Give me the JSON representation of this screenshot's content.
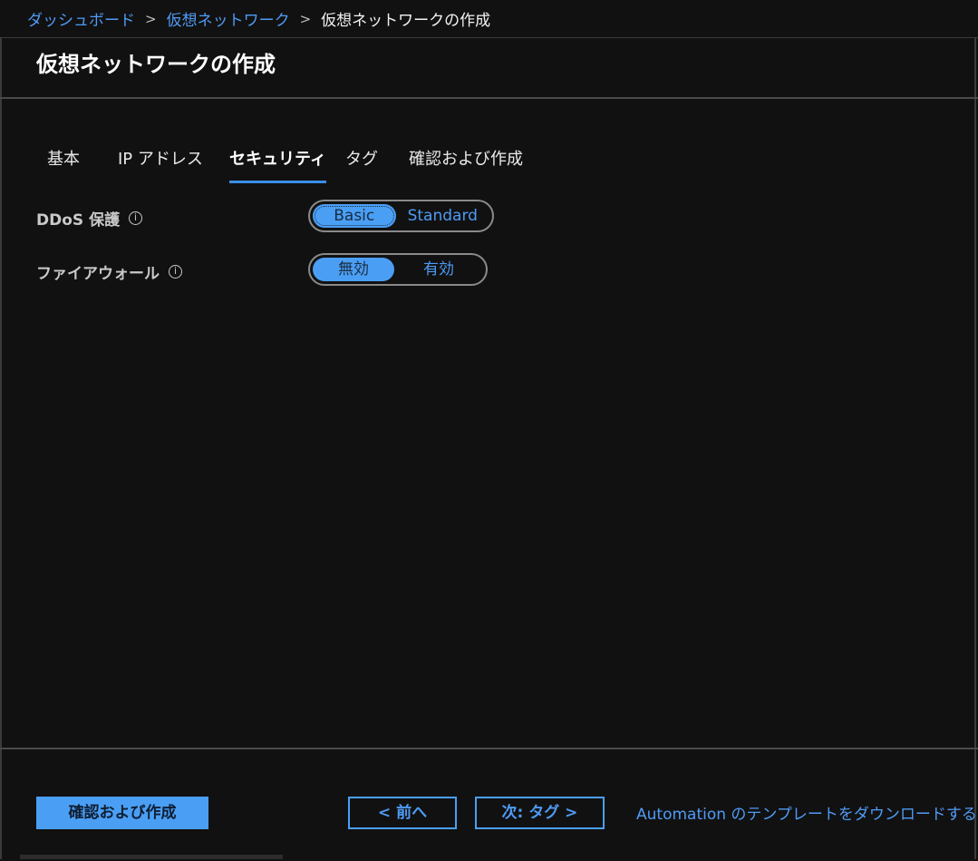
{
  "breadcrumb": {
    "items": [
      "ダッシュボード",
      "仮想ネットワーク"
    ],
    "separator": ">",
    "current": "仮想ネットワークの作成"
  },
  "page": {
    "title": "仮想ネットワークの作成"
  },
  "tabs": [
    {
      "label": "基本",
      "active": false
    },
    {
      "label": "IP アドレス",
      "active": false
    },
    {
      "label": "セキュリティ",
      "active": true
    },
    {
      "label": "タグ",
      "active": false
    },
    {
      "label": "確認および作成",
      "active": false
    }
  ],
  "settings": {
    "ddos": {
      "label": "DDoS 保護",
      "info_icon": "info-icon",
      "options": [
        "Basic",
        "Standard"
      ],
      "selected": "Basic"
    },
    "firewall": {
      "label": "ファイアウォール",
      "info_icon": "info-icon",
      "options": [
        "無効",
        "有効"
      ],
      "selected": "無効"
    }
  },
  "footer": {
    "review_create": "確認および作成",
    "previous": "< 前へ",
    "next": "次: タグ >",
    "automation_link": "Automation のテンプレートをダウンロードする"
  },
  "colors": {
    "background": "#111111",
    "accent": "#4a9ff5",
    "link": "#4f9bf5",
    "tab_underline": "#3a8ee6"
  }
}
